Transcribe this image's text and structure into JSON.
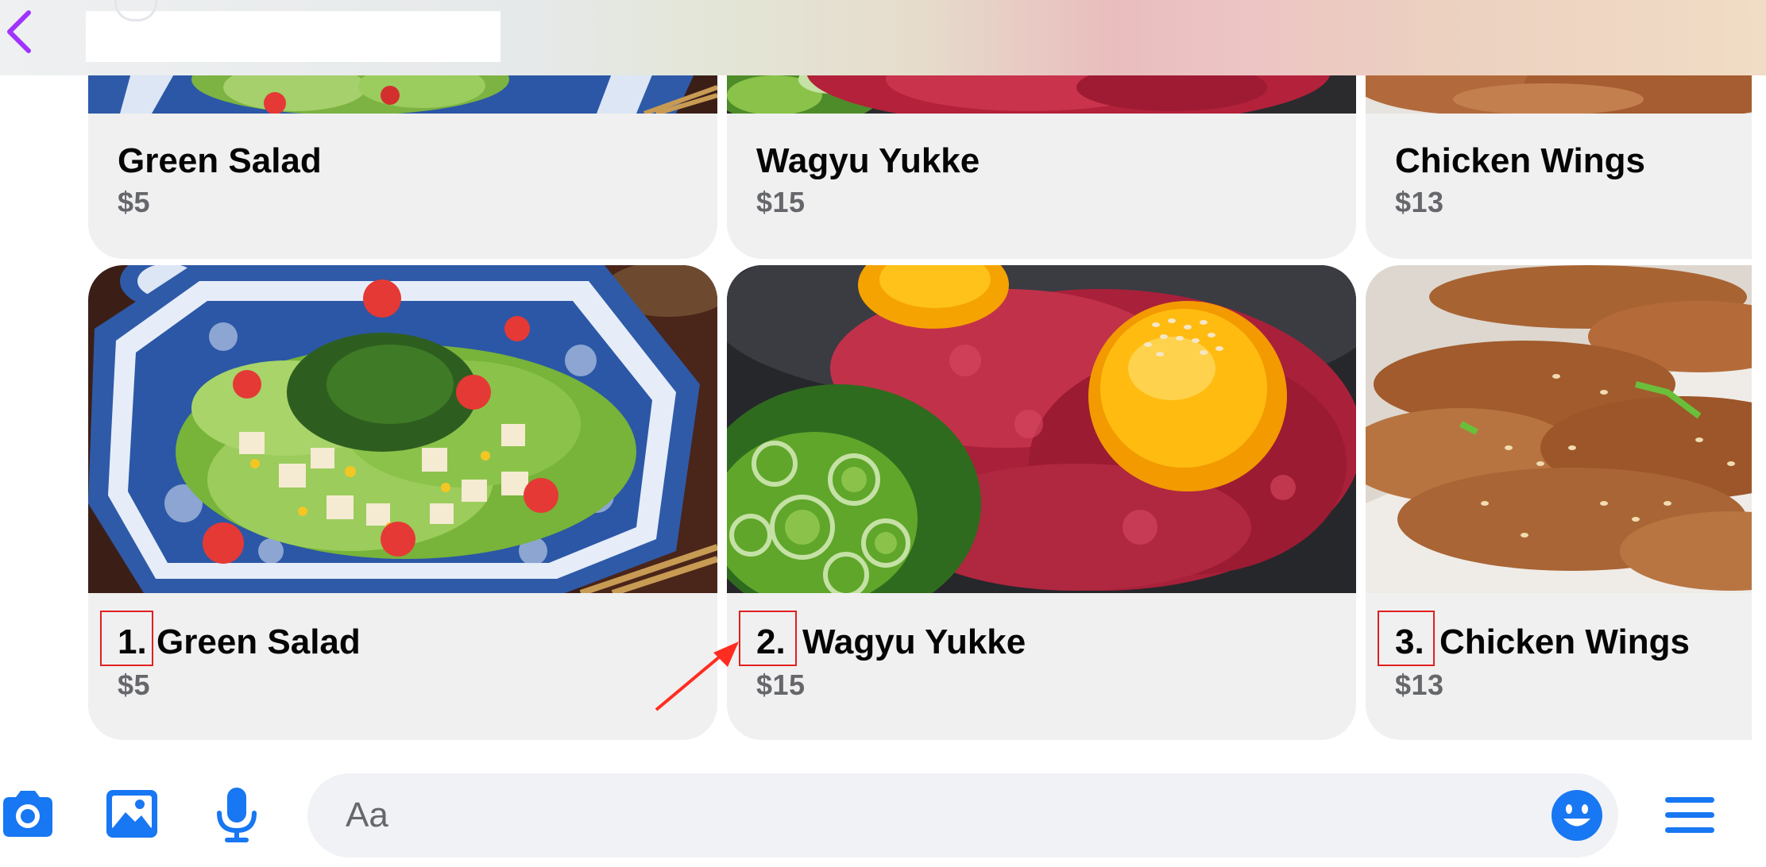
{
  "header": {
    "back_icon": "chevron-left-icon",
    "accent": "#a033ff"
  },
  "top_cards": [
    {
      "title": "Green Salad",
      "price": "$5"
    },
    {
      "title": "Wagyu Yukke",
      "price": "$15"
    },
    {
      "title": "Chicken Wings",
      "price": "$13"
    }
  ],
  "cards": [
    {
      "number": "1.",
      "title": "Green Salad",
      "price": "$5"
    },
    {
      "number": "2.",
      "title": "Wagyu Yukke",
      "price": "$15"
    },
    {
      "number": "3.",
      "title": "Chicken Wings",
      "price": "$13"
    }
  ],
  "composer": {
    "placeholder": "Aa",
    "icons": [
      "camera-icon",
      "photo-icon",
      "microphone-icon",
      "emoji-icon",
      "menu-icon"
    ],
    "accent": "#1877f2"
  },
  "annotation": {
    "box_color": "#e02020",
    "arrow_color": "#ff2d20"
  }
}
